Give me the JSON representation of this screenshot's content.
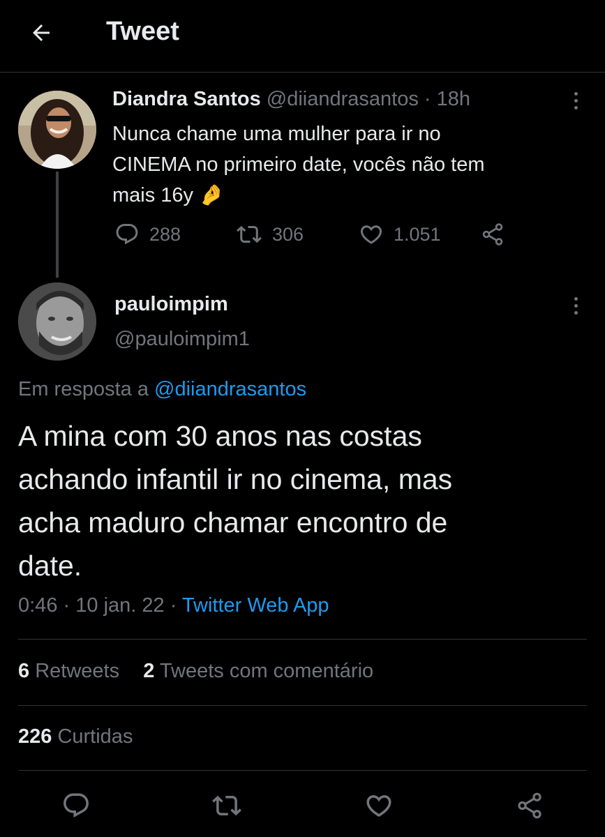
{
  "header": {
    "title": "Tweet"
  },
  "parent_tweet": {
    "display_name": "Diandra Santos",
    "handle": "@diiandrasantos",
    "separator": "·",
    "time": "18h",
    "text_line1": "Nunca chame uma mulher para ir no",
    "text_line2": "CINEMA no primeiro date, vocês não tem",
    "text_line3": "mais 16y",
    "emoji": "🤌",
    "replies": "288",
    "retweets": "306",
    "likes": "1.051"
  },
  "main_tweet": {
    "display_name": "pauloimpim",
    "handle": "@pauloimpim1",
    "reply_to_label": "Em resposta a",
    "reply_to_handle": "@diiandrasantos",
    "text_line1": "A mina com 30 anos nas costas",
    "text_line2": "achando infantil ir no cinema, mas",
    "text_line3": "acha maduro chamar encontro de",
    "text_line4": "date.",
    "time": "0:46",
    "date": "10 jan. 22",
    "sep1": "·",
    "sep2": "·",
    "source": "Twitter Web App"
  },
  "stats": {
    "retweets_count": "6",
    "retweets_label": "Retweets",
    "quotes_count": "2",
    "quotes_label": "Tweets com comentário",
    "likes_count": "226",
    "likes_label": "Curtidas"
  },
  "colors": {
    "background": "#000000",
    "text": "#e7e9ea",
    "muted": "#71767b",
    "accent": "#1d9bf0",
    "divider": "#2f3336"
  },
  "icons": {
    "back": "arrow-left-icon",
    "reply": "reply-icon",
    "retweet": "retweet-icon",
    "like": "heart-icon",
    "share": "share-icon",
    "more": "more-vertical-icon"
  }
}
